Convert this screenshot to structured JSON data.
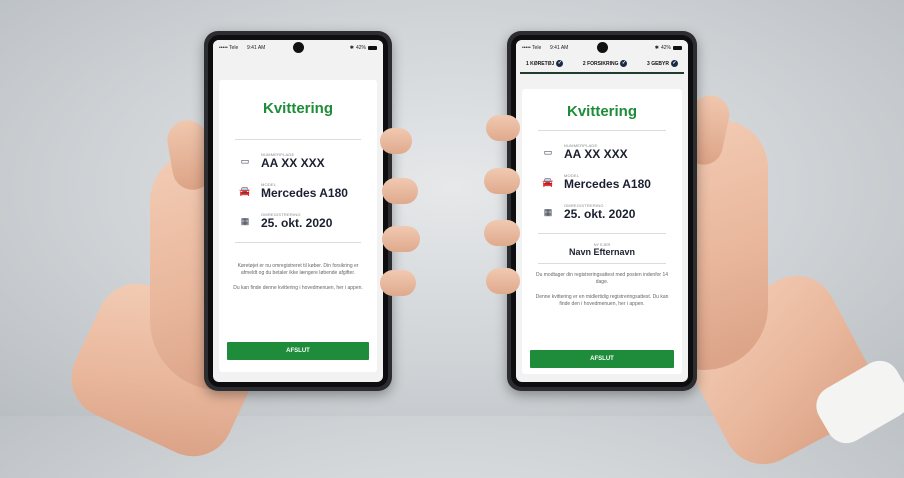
{
  "phones": {
    "left": {
      "status": {
        "carrier": "••••• Tele",
        "time": "9:41 AM",
        "battery": "42%"
      },
      "title": "Kvittering",
      "fields": [
        {
          "icon": "license-plate-icon",
          "label": "NUMMERPLADE",
          "value": "AA XX XXX"
        },
        {
          "icon": "car-icon",
          "label": "MODEL",
          "value": "Mercedes A180"
        },
        {
          "icon": "calendar-icon",
          "label": "OMREGISTRERING",
          "value": "25. okt. 2020"
        }
      ],
      "paragraph_1": "Køretøjet er nu omregistreret til køber. Din forsikring er afmeldt og du betaler ikke længere løbende afgifter.",
      "paragraph_2": "Du kan finde denne kvittering i hovedmenuen, her i appen.",
      "button": "AFSLUT"
    },
    "right": {
      "status": {
        "carrier": "••••• Tele",
        "time": "9:41 AM",
        "battery": "42%"
      },
      "steps": [
        {
          "label": "1 KØRETØJ"
        },
        {
          "label": "2 FORSIKRING"
        },
        {
          "label": "3 GEBYR"
        }
      ],
      "title": "Kvittering",
      "fields": [
        {
          "icon": "license-plate-icon",
          "label": "NUMMERPLADE",
          "value": "AA XX XXX"
        },
        {
          "icon": "car-icon",
          "label": "MODEL",
          "value": "Mercedes A180"
        },
        {
          "icon": "calendar-icon",
          "label": "OMREGISTRERING",
          "value": "25. okt. 2020"
        }
      ],
      "owner_label": "NY EJER",
      "owner_value": "Navn Efternavn",
      "paragraph_1": "Du modtager din registreringsattest med posten indenfor 14 dage.",
      "paragraph_2": "Denne kvittering er en midlertidig registreringsattest. Du kan finde den i hovedmenuen, her i appen.",
      "button": "AFSLUT"
    }
  },
  "colors": {
    "brand_green": "#1e8c3a",
    "navy": "#1b2a45",
    "screen_bg": "#f2f2f2"
  }
}
